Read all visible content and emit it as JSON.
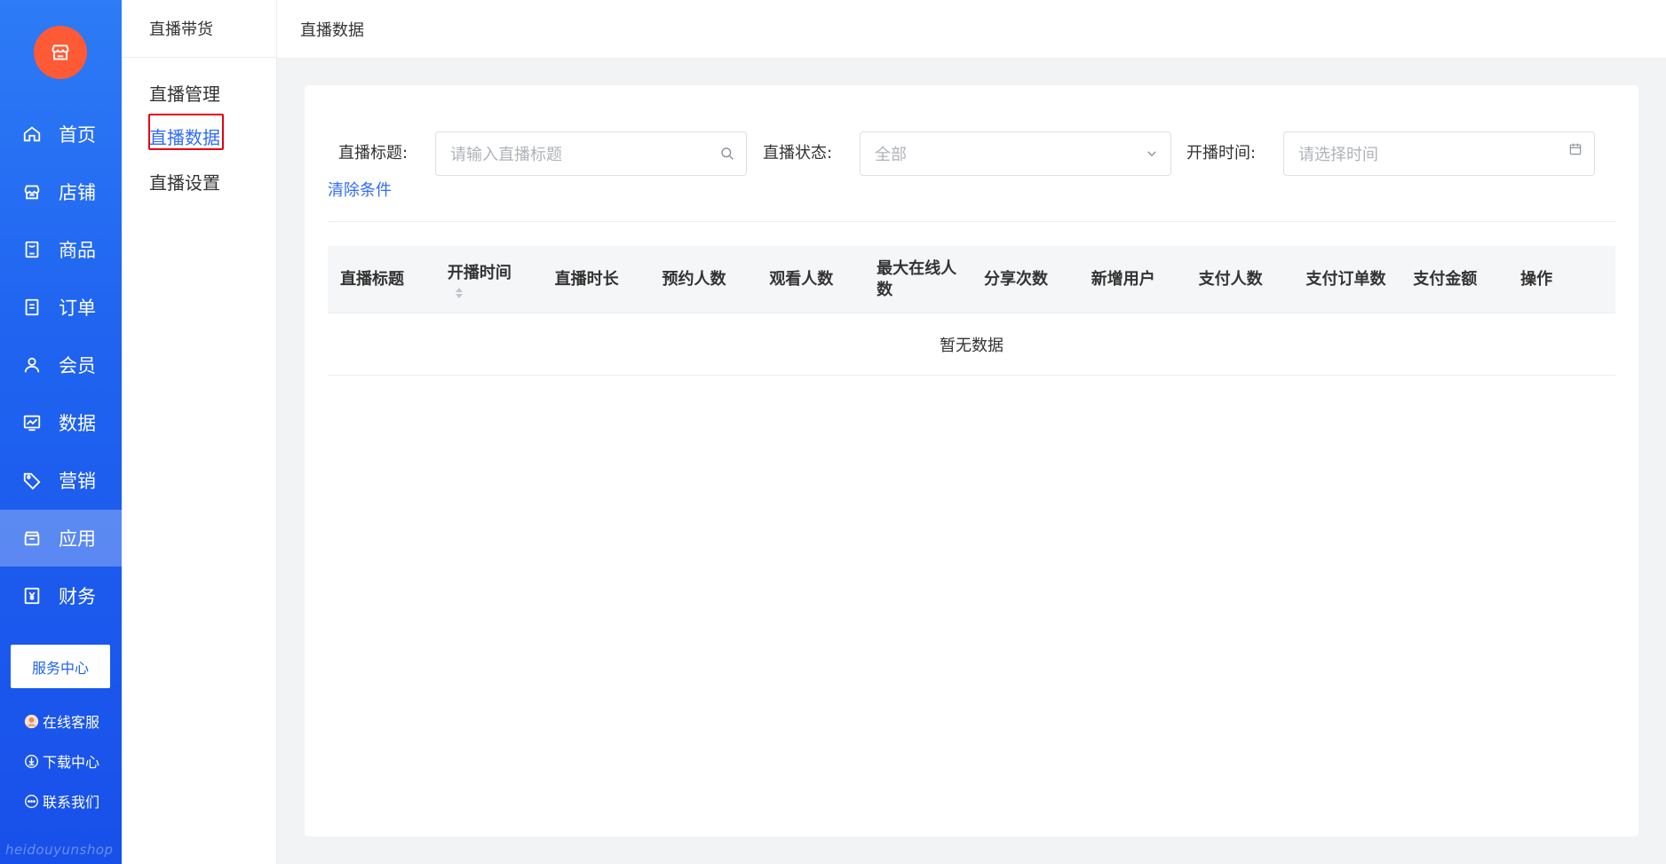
{
  "sidebar": {
    "logo_icon": "store-icon",
    "items": [
      {
        "label": "首页",
        "icon": "home-icon"
      },
      {
        "label": "店铺",
        "icon": "shop-icon"
      },
      {
        "label": "商品",
        "icon": "product-icon"
      },
      {
        "label": "订单",
        "icon": "order-icon"
      },
      {
        "label": "会员",
        "icon": "user-icon"
      },
      {
        "label": "数据",
        "icon": "chart-icon"
      },
      {
        "label": "营销",
        "icon": "tag-icon"
      },
      {
        "label": "应用",
        "icon": "app-icon"
      },
      {
        "label": "财务",
        "icon": "finance-icon"
      }
    ],
    "active_item": "应用",
    "service_center": "服务中心",
    "utilities": [
      {
        "label": "在线客服",
        "icon": "support-avatar-icon"
      },
      {
        "label": "下载中心",
        "icon": "download-icon"
      },
      {
        "label": "联系我们",
        "icon": "chat-icon"
      }
    ],
    "brand": "heidouyunshop"
  },
  "subnav": {
    "title": "直播带货",
    "items": [
      {
        "label": "直播管理"
      },
      {
        "label": "直播数据"
      },
      {
        "label": "直播设置"
      }
    ],
    "active_item": "直播数据"
  },
  "header": {
    "title": "直播数据"
  },
  "filters": {
    "title_label": "直播标题:",
    "title_placeholder": "请输入直播标题",
    "status_label": "直播状态:",
    "status_value": "全部",
    "time_label": "开播时间:",
    "time_placeholder": "请选择时间",
    "clear": "清除条件"
  },
  "table": {
    "columns": [
      "直播标题",
      "开播时间",
      "直播时长",
      "预约人数",
      "观看人数",
      "最大在线人数",
      "分享次数",
      "新增用户",
      "支付人数",
      "支付订单数",
      "支付金额",
      "操作"
    ],
    "empty_text": "暂无数据"
  },
  "colors": {
    "sidebar_blue": "#1f63f0",
    "accent": "#2f6cf6",
    "logo": "#ff5a36",
    "highlight": "#e60012"
  }
}
